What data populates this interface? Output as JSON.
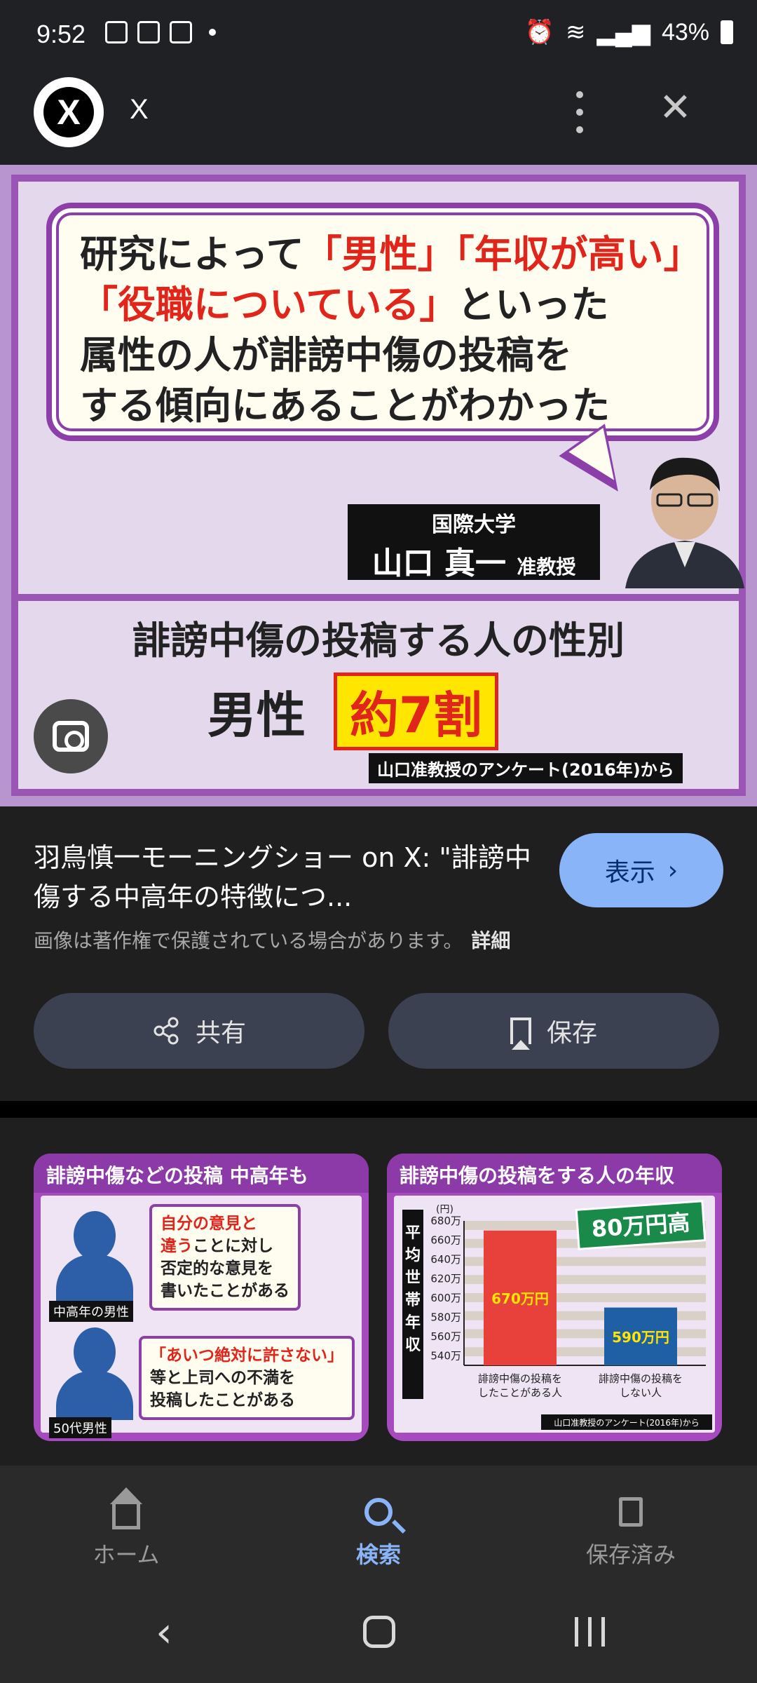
{
  "status_bar": {
    "time": "9:52",
    "battery": "43%"
  },
  "header": {
    "logo_letter": "X",
    "title": "X"
  },
  "main_image": {
    "quote_line1_a": "研究によって",
    "quote_line1_b": "「男性」「年収が高い」",
    "quote_line2_a": "「役職についている」",
    "quote_line2_b": "といった",
    "quote_line3": "属性の人が誹謗中傷の投稿を",
    "quote_line4": "する傾向にあることがわかった",
    "university": "国際大学",
    "name": "山口 真一",
    "title_suffix": "准教授",
    "sub_title": "誹謗中傷の投稿する人の性別",
    "stat_label": "男性",
    "stat_value": "約7割",
    "source": "山口准教授のアンケート(2016年)から"
  },
  "result": {
    "title": "羽鳥慎一モーニングショー on X: \"誹謗中傷する中高年の特徴につ...",
    "view_label": "表示",
    "copyright": "画像は著作権で保護されている場合があります。",
    "details_label": "詳細",
    "share_label": "共有",
    "save_label": "保存"
  },
  "thumb_a": {
    "heading": "誹謗中傷などの投稿 中高年も",
    "person1_tag": "中高年の男性",
    "note1_red": "自分の意見と",
    "note1_red2": "違う",
    "note1_rest": "ことに対し",
    "note1_line3": "否定的な意見を",
    "note1_line4": "書いたことがある",
    "person2_tag": "50代男性",
    "note2_red": "「あいつ絶対に許さない」",
    "note2_line2": "等と上司への不満を",
    "note2_line3": "投稿したことがある"
  },
  "thumb_b": {
    "heading": "誹謗中傷の投稿をする人の年収",
    "badge": "80万円高",
    "ylabel": "平均世帯年収"
  },
  "chart_data": {
    "type": "bar",
    "title": "誹謗中傷の投稿をする人の年収",
    "ylabel": "平均世帯年収",
    "y_unit": "(円)",
    "categories": [
      "誹謗中傷の投稿をしたことがある人",
      "誹謗中傷の投稿をしない人"
    ],
    "values": [
      670,
      590
    ],
    "value_labels": [
      "670万円",
      "590万円"
    ],
    "colors": [
      "#e8413c",
      "#1f5fa3"
    ],
    "ylim": [
      530,
      680
    ],
    "yticks": [
      "680万",
      "660万",
      "640万",
      "620万",
      "600万",
      "580万",
      "560万",
      "540万"
    ],
    "annotation": "80万円高",
    "source": "山口准教授のアンケート(2016年)から"
  },
  "bottom_nav": {
    "home": "ホーム",
    "search": "検索",
    "saved": "保存済み"
  }
}
